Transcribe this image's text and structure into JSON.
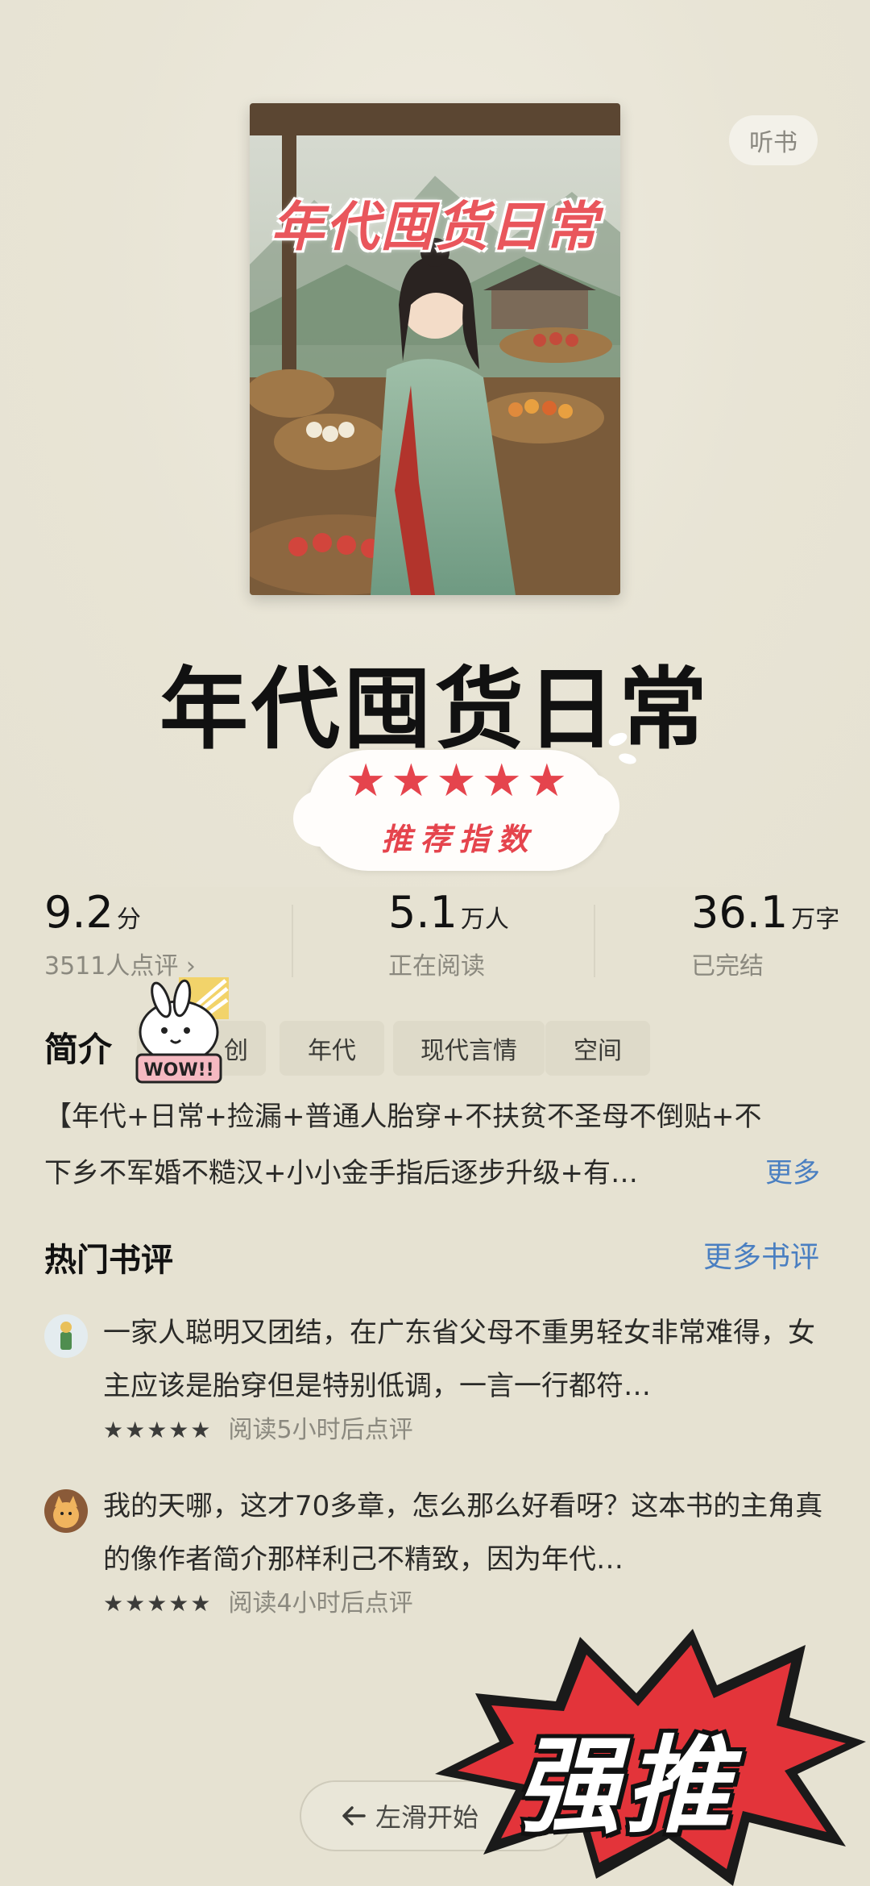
{
  "header": {
    "listen_label": "听书"
  },
  "cover": {
    "title": "年代囤货日常"
  },
  "book": {
    "title": "年代囤货日常"
  },
  "rating_sticker": {
    "stars": "★★★★★",
    "label": "推荐指数"
  },
  "stats": [
    {
      "value": "9.2",
      "unit": "分",
      "sub": "3511人点评 ›"
    },
    {
      "value": "5.1",
      "unit": "万人",
      "sub": "正在阅读"
    },
    {
      "value": "36.1",
      "unit": "万字",
      "sub": "已完结"
    }
  ],
  "intro": {
    "heading": "简介",
    "tags": [
      "创",
      "年代",
      "现代言情",
      "空间"
    ],
    "sticker_text": "WOW!!",
    "line1": "【年代+日常+捡漏+普通人胎穿+不扶贫不圣母不倒贴+不",
    "line2": "下乡不军婚不糙汉+小小金手指后逐步升级+有…",
    "more": "更多"
  },
  "reviews": {
    "heading": "热门书评",
    "more": "更多书评",
    "items": [
      {
        "text": "一家人聪明又团结，在广东省父母不重男轻女非常难得，女主应该是胎穿但是特别低调，一言一行都符…",
        "stars": "★★★★★",
        "meta": "阅读5小时后点评"
      },
      {
        "text": "我的天哪，这才70多章，怎么那么好看呀？这本书的主角真的像作者简介那样利己不精致，因为年代…",
        "stars": "★★★★★",
        "meta": "阅读4小时后点评"
      }
    ]
  },
  "bottom": {
    "swipe_label": "左滑开始",
    "arrow_icon": "arrow-left-icon",
    "promo_text": "强推"
  },
  "colors": {
    "accent_red": "#e5444d",
    "link_blue": "#4a7fc1",
    "background": "#e6e2d2"
  }
}
